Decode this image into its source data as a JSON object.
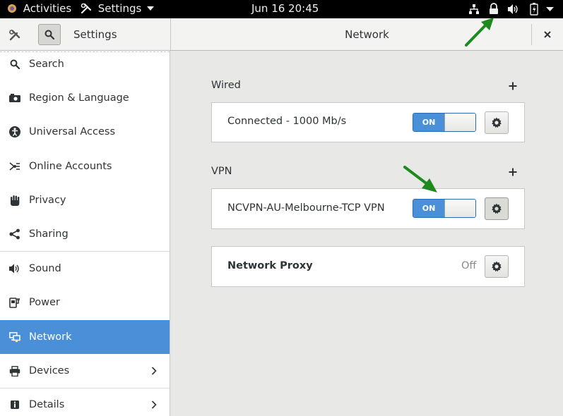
{
  "topbar": {
    "activities_label": "Activities",
    "app_menu_label": "Settings",
    "clock": "Jun 16  20:45"
  },
  "titlebar": {
    "sidebar_title": "Settings",
    "panel_title": "Network"
  },
  "sidebar": {
    "items": [
      {
        "label": "Search",
        "icon": "search-icon"
      },
      {
        "label": "Region & Language",
        "icon": "camera-icon"
      },
      {
        "label": "Universal Access",
        "icon": "accessibility-icon"
      },
      {
        "label": "Online Accounts",
        "icon": "online-accounts-icon"
      },
      {
        "label": "Privacy",
        "icon": "hand-icon"
      },
      {
        "label": "Sharing",
        "icon": "share-icon"
      },
      {
        "label": "Sound",
        "icon": "speaker-icon"
      },
      {
        "label": "Power",
        "icon": "power-icon"
      },
      {
        "label": "Network",
        "icon": "network-icon"
      },
      {
        "label": "Devices",
        "icon": "printer-icon"
      },
      {
        "label": "Details",
        "icon": "info-icon"
      }
    ],
    "active_item": "Network"
  },
  "network": {
    "wired": {
      "title": "Wired",
      "connection_label": "Connected - 1000 Mb/s",
      "switch_label": "ON"
    },
    "vpn": {
      "title": "VPN",
      "connection_label": "NCVPN-AU-Melbourne-TCP VPN",
      "switch_label": "ON"
    },
    "proxy": {
      "label": "Network Proxy",
      "status": "Off"
    }
  },
  "colors": {
    "accent": "#4a90d9",
    "annotation_arrow": "#1e8a1e"
  }
}
